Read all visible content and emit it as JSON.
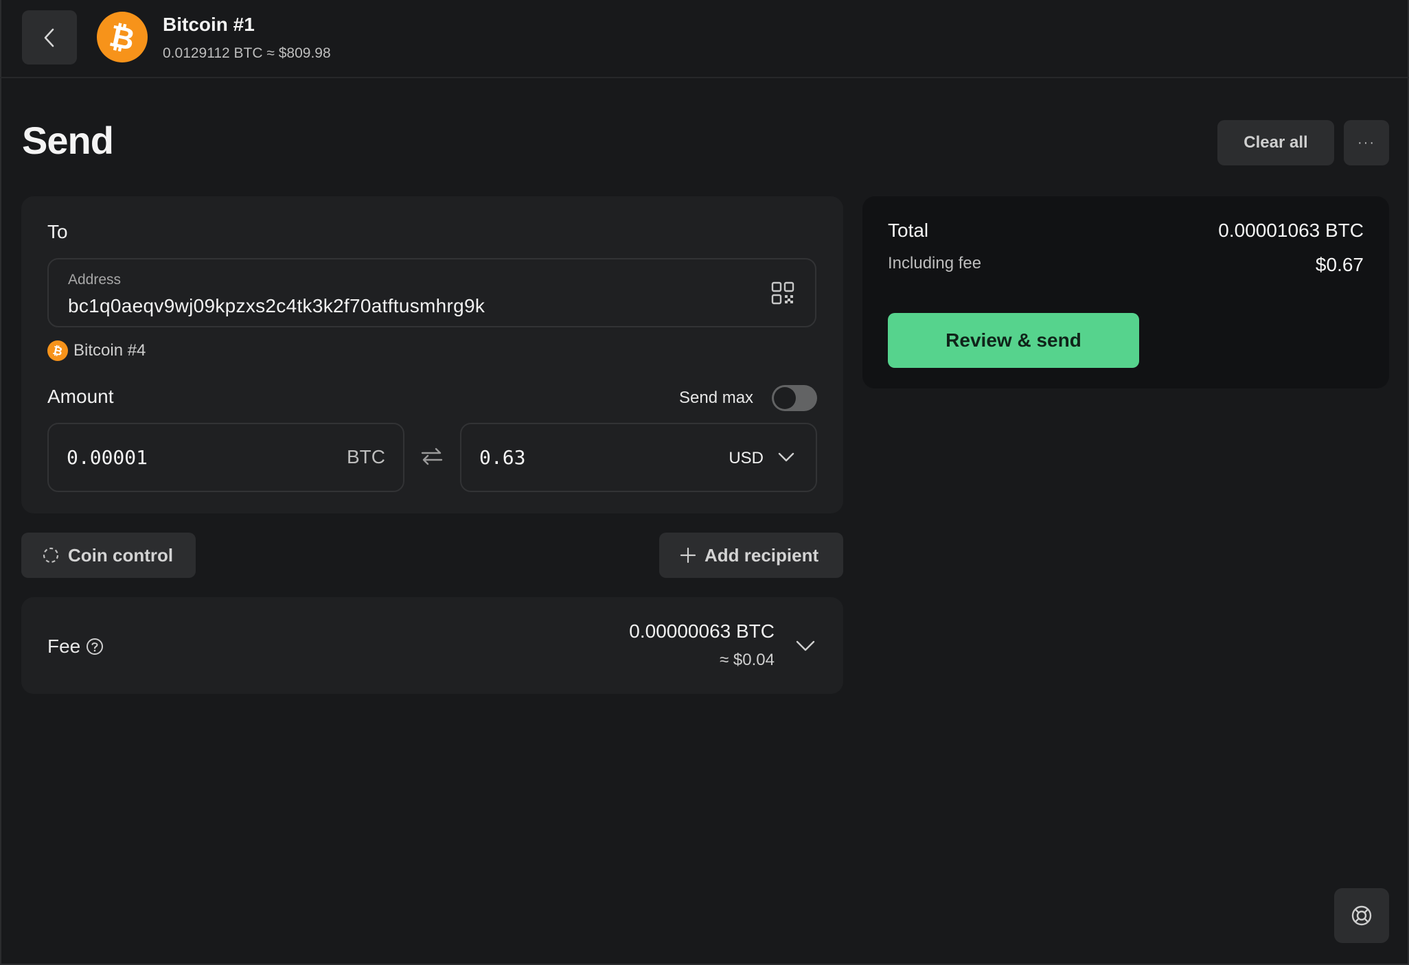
{
  "header": {
    "wallet_name": "Bitcoin #1",
    "wallet_balance": "0.0129112 BTC ≈ $809.98"
  },
  "page": {
    "title": "Send",
    "clear_all_label": "Clear all",
    "more_label": "···"
  },
  "recipient": {
    "to_label": "To",
    "address_label": "Address",
    "address_value": "bc1q0aeqv9wj09kpzxs2c4tk3k2f70atftusmhrg9k",
    "matched_wallet": "Bitcoin #4",
    "amount_label": "Amount",
    "send_max_label": "Send max",
    "send_max_on": false,
    "btc_amount": "0.00001",
    "btc_unit": "BTC",
    "fiat_amount": "0.63",
    "fiat_unit": "USD"
  },
  "actions": {
    "coin_control_label": "Coin control",
    "add_recipient_label": "Add recipient"
  },
  "fee": {
    "label": "Fee",
    "btc": "0.00000063 BTC",
    "usd": "≈ $0.04"
  },
  "summary": {
    "total_label": "Total",
    "total_value": "0.00001063 BTC",
    "including_fee_label": "Including fee",
    "including_fee_value": "$0.67",
    "review_label": "Review & send"
  },
  "colors": {
    "background": "#18191b",
    "card": "#1f2022",
    "accent_green": "#56d38d",
    "bitcoin_orange": "#f7931a"
  }
}
